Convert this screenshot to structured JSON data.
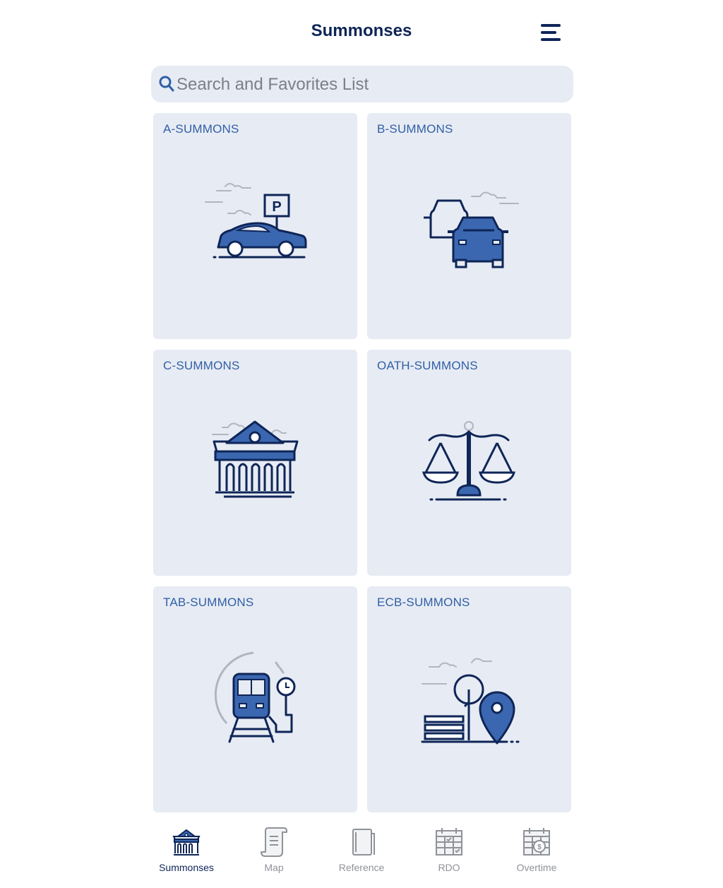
{
  "header": {
    "title": "Summonses"
  },
  "search": {
    "placeholder": "Search and Favorites List"
  },
  "tiles": [
    {
      "label": "A-SUMMONS",
      "icon": "parked-car-icon"
    },
    {
      "label": "B-SUMMONS",
      "icon": "traffic-cars-icon"
    },
    {
      "label": "C-SUMMONS",
      "icon": "courthouse-icon"
    },
    {
      "label": "OATH-SUMMONS",
      "icon": "scales-of-justice-icon"
    },
    {
      "label": "TAB-SUMMONS",
      "icon": "subway-train-icon"
    },
    {
      "label": "ECB-SUMMONS",
      "icon": "park-location-icon"
    }
  ],
  "tabbar": {
    "active": "Summonses",
    "items": [
      {
        "label": "Summonses",
        "icon": "courthouse-icon"
      },
      {
        "label": "Map",
        "icon": "map-scroll-icon"
      },
      {
        "label": "Reference",
        "icon": "book-icon"
      },
      {
        "label": "RDO",
        "icon": "calendar-check-icon"
      },
      {
        "label": "Overtime",
        "icon": "calendar-dollar-icon"
      }
    ]
  },
  "colors": {
    "navy": "#0e2557",
    "accent": "#3b67b0",
    "tile_bg": "#e7ebf3",
    "inactive": "#8f9298"
  }
}
